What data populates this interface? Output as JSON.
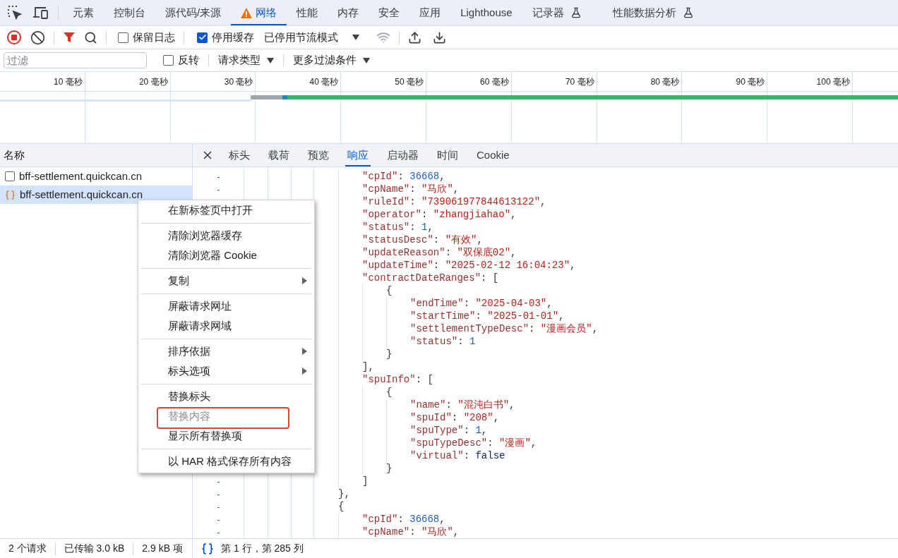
{
  "devtools_tabs": [
    {
      "label": "元素",
      "selected": false,
      "warning": false,
      "experimental": false
    },
    {
      "label": "控制台",
      "selected": false,
      "warning": false,
      "experimental": false
    },
    {
      "label": "源代码/来源",
      "selected": false,
      "warning": false,
      "experimental": false
    },
    {
      "label": "网络",
      "selected": true,
      "warning": true,
      "experimental": false
    },
    {
      "label": "性能",
      "selected": false,
      "warning": false,
      "experimental": false
    },
    {
      "label": "内存",
      "selected": false,
      "warning": false,
      "experimental": false
    },
    {
      "label": "安全",
      "selected": false,
      "warning": false,
      "experimental": false
    },
    {
      "label": "应用",
      "selected": false,
      "warning": false,
      "experimental": false
    },
    {
      "label": "Lighthouse",
      "selected": false,
      "warning": false,
      "experimental": false
    },
    {
      "label": "记录器",
      "selected": false,
      "warning": false,
      "experimental": true
    },
    {
      "label": "性能数据分析",
      "selected": false,
      "warning": false,
      "experimental": true
    }
  ],
  "toolbar": {
    "recording": true,
    "preserve_log": {
      "label": "保留日志",
      "checked": false
    },
    "disable_cache": {
      "label": "停用缓存",
      "checked": true
    },
    "throttling": "已停用节流模式"
  },
  "filter_bar": {
    "placeholder": "过滤",
    "invert": {
      "label": "反转",
      "checked": false
    },
    "dropdowns": [
      "请求类型",
      "更多过滤条件"
    ]
  },
  "overview": {
    "ticks": [
      "10 毫秒",
      "20 毫秒",
      "30 毫秒",
      "40 毫秒",
      "50 毫秒",
      "60 毫秒",
      "70 毫秒",
      "80 毫秒",
      "90 毫秒",
      "100 毫秒"
    ]
  },
  "request_list": {
    "header": "名称",
    "rows": [
      {
        "name": "bff-settlement.quickcan.cn",
        "kind": "document",
        "selected": false
      },
      {
        "name": "bff-settlement.quickcan.cn",
        "kind": "fetch",
        "selected": true
      }
    ]
  },
  "detail_tabs": [
    {
      "label": "标头",
      "selected": false
    },
    {
      "label": "载荷",
      "selected": false
    },
    {
      "label": "预览",
      "selected": false
    },
    {
      "label": "响应",
      "selected": true
    },
    {
      "label": "启动器",
      "selected": false
    },
    {
      "label": "时间",
      "selected": false
    },
    {
      "label": "Cookie",
      "selected": false
    }
  ],
  "gutter_top": [
    "-",
    "-"
  ],
  "gutter_bottom": [
    "-",
    "-",
    "-",
    "-",
    "-"
  ],
  "response_lines": [
    {
      "children": [
        {
          "tokens": [
            {
              "kind": "key",
              "text": "\"cpId\""
            },
            {
              "kind": "punct",
              "text": ": "
            },
            {
              "kind": "number",
              "text": "36668"
            },
            {
              "kind": "punct",
              "text": ","
            }
          ]
        },
        {
          "tokens": [
            {
              "kind": "key",
              "text": "\"cpName\""
            },
            {
              "kind": "punct",
              "text": ": "
            },
            {
              "kind": "string",
              "text": "\"马欣\""
            },
            {
              "kind": "punct",
              "text": ","
            }
          ]
        },
        {
          "tokens": [
            {
              "kind": "key",
              "text": "\"ruleId\""
            },
            {
              "kind": "punct",
              "text": ": "
            },
            {
              "kind": "string",
              "text": "\"739061977844613122\""
            },
            {
              "kind": "punct",
              "text": ","
            }
          ]
        },
        {
          "tokens": [
            {
              "kind": "key",
              "text": "\"operator\""
            },
            {
              "kind": "punct",
              "text": ": "
            },
            {
              "kind": "string",
              "text": "\"zhangjiahao\""
            },
            {
              "kind": "punct",
              "text": ","
            }
          ]
        },
        {
          "tokens": [
            {
              "kind": "key",
              "text": "\"status\""
            },
            {
              "kind": "punct",
              "text": ": "
            },
            {
              "kind": "number",
              "text": "1"
            },
            {
              "kind": "punct",
              "text": ","
            }
          ]
        },
        {
          "tokens": [
            {
              "kind": "key",
              "text": "\"statusDesc\""
            },
            {
              "kind": "punct",
              "text": ": "
            },
            {
              "kind": "string",
              "text": "\"有效\""
            },
            {
              "kind": "punct",
              "text": ","
            }
          ]
        },
        {
          "tokens": [
            {
              "kind": "key",
              "text": "\"updateReason\""
            },
            {
              "kind": "punct",
              "text": ": "
            },
            {
              "kind": "string",
              "text": "\"双保底02\""
            },
            {
              "kind": "punct",
              "text": ","
            }
          ]
        },
        {
          "tokens": [
            {
              "kind": "key",
              "text": "\"updateTime\""
            },
            {
              "kind": "punct",
              "text": ": "
            },
            {
              "kind": "string",
              "text": "\"2025-02-12 16:04:23\""
            },
            {
              "kind": "punct",
              "text": ","
            }
          ]
        },
        {
          "tokens": [
            {
              "kind": "key",
              "text": "\"contractDateRanges\""
            },
            {
              "kind": "punct",
              "text": ": ["
            }
          ],
          "children": [
            {
              "tokens": [
                {
                  "kind": "punct",
                  "text": "{"
                }
              ],
              "children": [
                {
                  "tokens": [
                    {
                      "kind": "key",
                      "text": "\"endTime\""
                    },
                    {
                      "kind": "punct",
                      "text": ": "
                    },
                    {
                      "kind": "string",
                      "text": "\"2025-04-03\""
                    },
                    {
                      "kind": "punct",
                      "text": ","
                    }
                  ]
                },
                {
                  "tokens": [
                    {
                      "kind": "key",
                      "text": "\"startTime\""
                    },
                    {
                      "kind": "punct",
                      "text": ": "
                    },
                    {
                      "kind": "string",
                      "text": "\"2025-01-01\""
                    },
                    {
                      "kind": "punct",
                      "text": ","
                    }
                  ]
                },
                {
                  "tokens": [
                    {
                      "kind": "key",
                      "text": "\"settlementTypeDesc\""
                    },
                    {
                      "kind": "punct",
                      "text": ": "
                    },
                    {
                      "kind": "string",
                      "text": "\"漫画会员\""
                    },
                    {
                      "kind": "punct",
                      "text": ","
                    }
                  ]
                },
                {
                  "tokens": [
                    {
                      "kind": "key",
                      "text": "\"status\""
                    },
                    {
                      "kind": "punct",
                      "text": ": "
                    },
                    {
                      "kind": "number",
                      "text": "1"
                    }
                  ]
                }
              ]
            },
            {
              "tokens": [
                {
                  "kind": "punct",
                  "text": "}"
                }
              ]
            }
          ]
        },
        {
          "tokens": [
            {
              "kind": "punct",
              "text": "],"
            }
          ]
        },
        {
          "tokens": [
            {
              "kind": "key",
              "text": "\"spuInfo\""
            },
            {
              "kind": "punct",
              "text": ": ["
            }
          ],
          "children": [
            {
              "tokens": [
                {
                  "kind": "punct",
                  "text": "{"
                }
              ],
              "children": [
                {
                  "tokens": [
                    {
                      "kind": "key",
                      "text": "\"name\""
                    },
                    {
                      "kind": "punct",
                      "text": ": "
                    },
                    {
                      "kind": "string",
                      "text": "\"混沌白书\""
                    },
                    {
                      "kind": "punct",
                      "text": ","
                    }
                  ]
                },
                {
                  "tokens": [
                    {
                      "kind": "key",
                      "text": "\"spuId\""
                    },
                    {
                      "kind": "punct",
                      "text": ": "
                    },
                    {
                      "kind": "string",
                      "text": "\"208\""
                    },
                    {
                      "kind": "punct",
                      "text": ","
                    }
                  ]
                },
                {
                  "tokens": [
                    {
                      "kind": "key",
                      "text": "\"spuType\""
                    },
                    {
                      "kind": "punct",
                      "text": ": "
                    },
                    {
                      "kind": "number",
                      "text": "1"
                    },
                    {
                      "kind": "punct",
                      "text": ","
                    }
                  ]
                },
                {
                  "tokens": [
                    {
                      "kind": "key",
                      "text": "\"spuTypeDesc\""
                    },
                    {
                      "kind": "punct",
                      "text": ": "
                    },
                    {
                      "kind": "string",
                      "text": "\"漫画\""
                    },
                    {
                      "kind": "punct",
                      "text": ","
                    }
                  ]
                },
                {
                  "tokens": [
                    {
                      "kind": "key",
                      "text": "\"virtual\""
                    },
                    {
                      "kind": "punct",
                      "text": ": "
                    },
                    {
                      "kind": "literal",
                      "text": "false"
                    }
                  ]
                }
              ]
            },
            {
              "tokens": [
                {
                  "kind": "punct",
                  "text": "}"
                }
              ]
            }
          ]
        },
        {
          "tokens": [
            {
              "kind": "punct",
              "text": "]"
            }
          ]
        }
      ]
    },
    {
      "tokens": [
        {
          "kind": "punct",
          "text": "},"
        }
      ]
    },
    {
      "tokens": [
        {
          "kind": "punct",
          "text": "{"
        }
      ],
      "children": [
        {
          "tokens": [
            {
              "kind": "key",
              "text": "\"cpId\""
            },
            {
              "kind": "punct",
              "text": ": "
            },
            {
              "kind": "number",
              "text": "36668"
            },
            {
              "kind": "punct",
              "text": ","
            }
          ]
        },
        {
          "tokens": [
            {
              "kind": "key",
              "text": "\"cpName\""
            },
            {
              "kind": "punct",
              "text": ": "
            },
            {
              "kind": "string",
              "text": "\"马欣\""
            },
            {
              "kind": "punct",
              "text": ","
            }
          ]
        }
      ]
    }
  ],
  "context_menu": {
    "groups": [
      [
        {
          "label": "在新标签页中打开",
          "submenu": false,
          "disabled": false,
          "highlighted": false
        }
      ],
      [
        {
          "label": "清除浏览器缓存",
          "submenu": false,
          "disabled": false,
          "highlighted": false
        },
        {
          "label": "清除浏览器 Cookie",
          "submenu": false,
          "disabled": false,
          "highlighted": false
        }
      ],
      [
        {
          "label": "复制",
          "submenu": true,
          "disabled": false,
          "highlighted": false
        }
      ],
      [
        {
          "label": "屏蔽请求网址",
          "submenu": false,
          "disabled": false,
          "highlighted": false
        },
        {
          "label": "屏蔽请求网域",
          "submenu": false,
          "disabled": false,
          "highlighted": false
        }
      ],
      [
        {
          "label": "排序依据",
          "submenu": true,
          "disabled": false,
          "highlighted": false
        },
        {
          "label": "标头选项",
          "submenu": true,
          "disabled": false,
          "highlighted": false
        }
      ],
      [
        {
          "label": "替换标头",
          "submenu": false,
          "disabled": false,
          "highlighted": false
        },
        {
          "label": "替换内容",
          "submenu": false,
          "disabled": true,
          "highlighted": true
        },
        {
          "label": "显示所有替换项",
          "submenu": false,
          "disabled": false,
          "highlighted": false
        }
      ],
      [
        {
          "label": "以 HAR 格式保存所有内容",
          "submenu": false,
          "disabled": false,
          "highlighted": false
        }
      ]
    ]
  },
  "status_bar": {
    "summary": [
      "2 个请求",
      "已传输 3.0 kB",
      "2.9 kB 项"
    ],
    "position": "第 1 行，第 285 列"
  }
}
